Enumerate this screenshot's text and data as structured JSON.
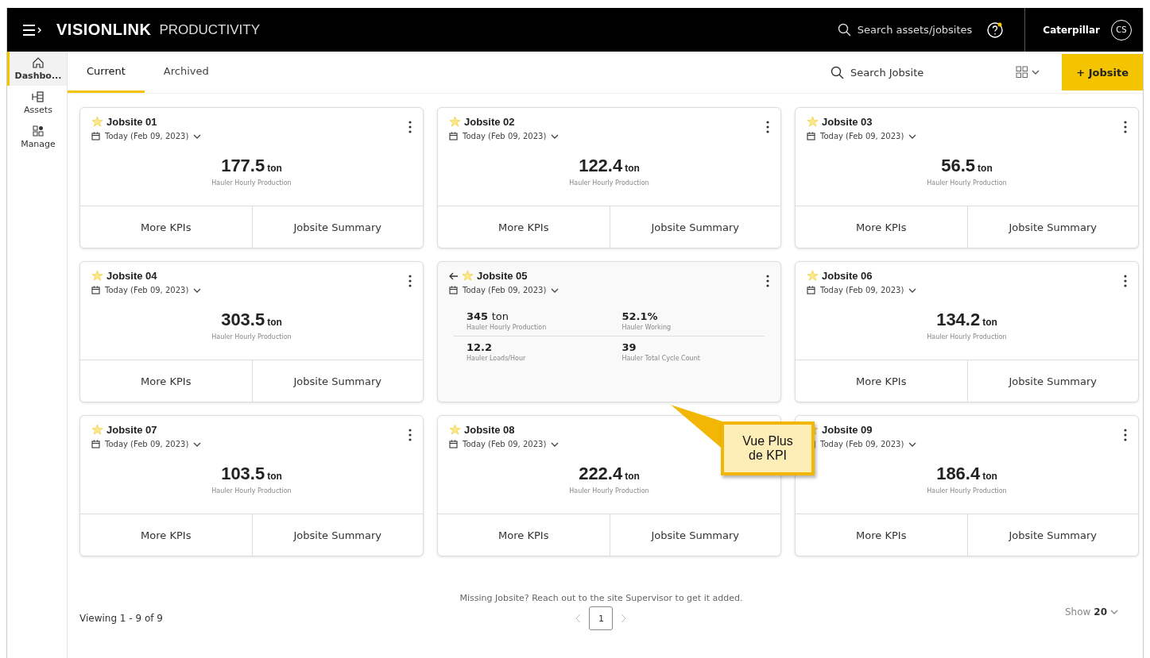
{
  "header": {
    "brand": "VISIONLINK",
    "brand_suffix": "PRODUCTIVITY",
    "search_placeholder": "Search assets/jobsites",
    "account": "Caterpillar",
    "avatar": "CS"
  },
  "sidebar": {
    "items": [
      {
        "label": "Dashbo...",
        "kind": "home",
        "selected": true
      },
      {
        "label": "Assets",
        "kind": "assets",
        "selected": false
      },
      {
        "label": "Manage",
        "kind": "manage",
        "selected": false
      }
    ]
  },
  "tabs": [
    {
      "label": "Current",
      "selected": true
    },
    {
      "label": "Archived",
      "selected": false
    }
  ],
  "toolbar": {
    "search_placeholder": "Search Jobsite",
    "add_button": "+ Jobsite"
  },
  "cards": [
    {
      "kind": "summary",
      "title": "Jobsite 01",
      "date": "Today (Feb 09, 2023)",
      "value": "177.5",
      "unit": "ton",
      "metric": "Hauler Hourly Production",
      "buttons": [
        "More KPIs",
        "Jobsite Summary"
      ]
    },
    {
      "kind": "summary",
      "title": "Jobsite 02",
      "date": "Today (Feb 09, 2023)",
      "value": "122.4",
      "unit": "ton",
      "metric": "Hauler Hourly Production",
      "buttons": [
        "More KPIs",
        "Jobsite Summary"
      ]
    },
    {
      "kind": "summary",
      "title": "Jobsite 03",
      "date": "Today (Feb 09, 2023)",
      "value": "56.5",
      "unit": "ton",
      "metric": "Hauler Hourly Production",
      "buttons": [
        "More KPIs",
        "Jobsite Summary"
      ]
    },
    {
      "kind": "summary",
      "title": "Jobsite 04",
      "date": "Today (Feb 09, 2023)",
      "value": "303.5",
      "unit": "ton",
      "metric": "Hauler Hourly Production",
      "buttons": [
        "More KPIs",
        "Jobsite Summary"
      ]
    },
    {
      "kind": "kpis",
      "title": "Jobsite 05",
      "date": "Today (Feb 09, 2023)",
      "kpis": [
        {
          "value": "345",
          "unit": "ton",
          "label": "Hauler Hourly Production"
        },
        {
          "value": "52.1%",
          "label": "Hauler Working"
        },
        {
          "value": "12.2",
          "label": "Hauler Loads/Hour"
        },
        {
          "value": "39",
          "label": "Hauler Total Cycle Count"
        }
      ]
    },
    {
      "kind": "summary",
      "title": "Jobsite 06",
      "date": "Today (Feb 09, 2023)",
      "value": "134.2",
      "unit": "ton",
      "metric": "Hauler Hourly Production",
      "buttons": [
        "More KPIs",
        "Jobsite Summary"
      ]
    },
    {
      "kind": "summary",
      "title": "Jobsite 07",
      "date": "Today (Feb 09, 2023)",
      "value": "103.5",
      "unit": "ton",
      "metric": "Hauler Hourly Production",
      "buttons": [
        "More KPIs",
        "Jobsite Summary"
      ]
    },
    {
      "kind": "summary",
      "title": "Jobsite 08",
      "date": "Today (Feb 09, 2023)",
      "value": "222.4",
      "unit": "ton",
      "metric": "Hauler Hourly Production",
      "buttons": [
        "More KPIs",
        "Jobsite Summary"
      ]
    },
    {
      "kind": "summary",
      "title": "Jobsite 09",
      "date": "Today (Feb 09, 2023)",
      "value": "186.4",
      "unit": "ton",
      "metric": "Hauler Hourly Production",
      "buttons": [
        "More KPIs",
        "Jobsite Summary"
      ]
    }
  ],
  "callout": {
    "text": "Vue Plus de KPI"
  },
  "footer": {
    "viewing": "Viewing 1 - 9 of 9",
    "note": "Missing Jobsite? Reach out to the site Supervisor to get it added.",
    "pages": [
      {
        "label": "1",
        "selected": true
      }
    ],
    "show_label": "Show",
    "show_value": "20"
  }
}
